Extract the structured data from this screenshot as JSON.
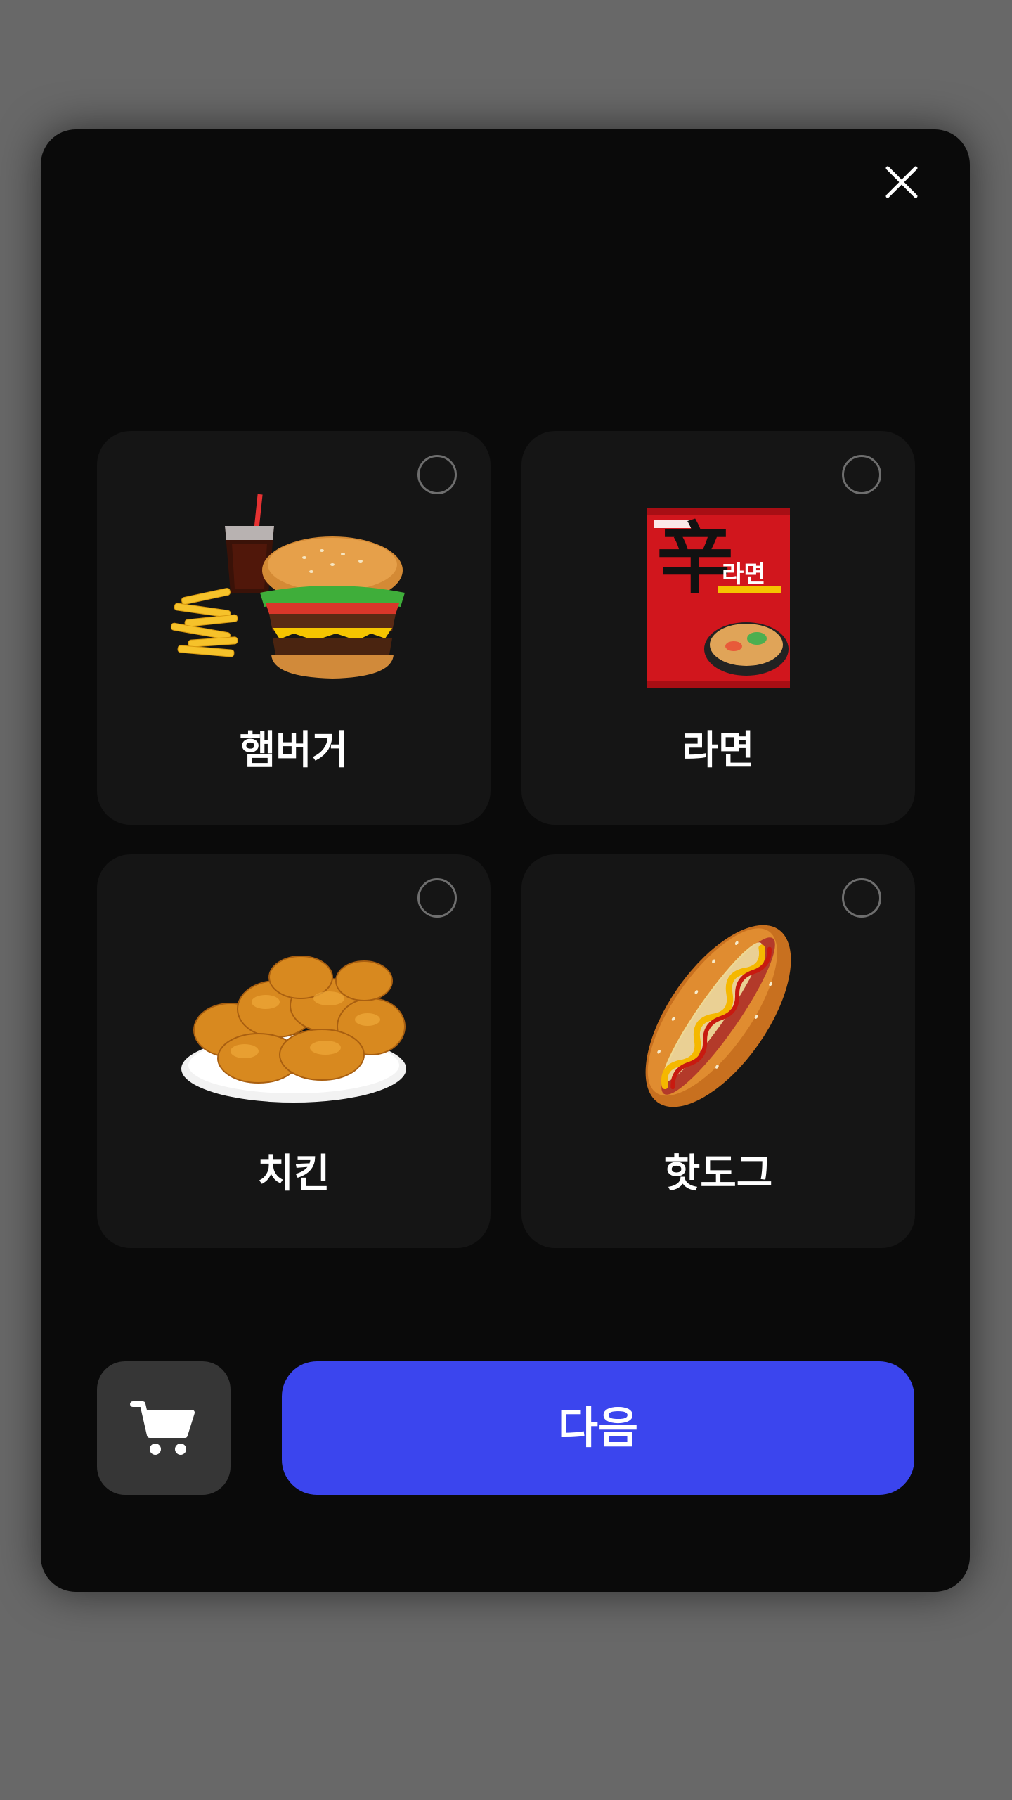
{
  "dialog": {
    "close_icon": "close-icon"
  },
  "options": [
    {
      "label": "햄버거",
      "icon": "hamburger-set-image",
      "selected": false
    },
    {
      "label": "라면",
      "icon": "ramen-package-image",
      "selected": false,
      "package_text": "辛",
      "package_sub": "라면"
    },
    {
      "label": "치킨",
      "icon": "fried-chicken-image",
      "selected": false
    },
    {
      "label": "핫도그",
      "icon": "hotdog-image",
      "selected": false
    }
  ],
  "footer": {
    "cart_icon": "cart-icon",
    "next_label": "다음"
  },
  "colors": {
    "page_bg": "#686868",
    "modal_bg": "#0a0a0a",
    "card_bg": "#151515",
    "cart_bg": "#363636",
    "accent": "#3b45ee",
    "radio_border": "#6e6e6e"
  }
}
